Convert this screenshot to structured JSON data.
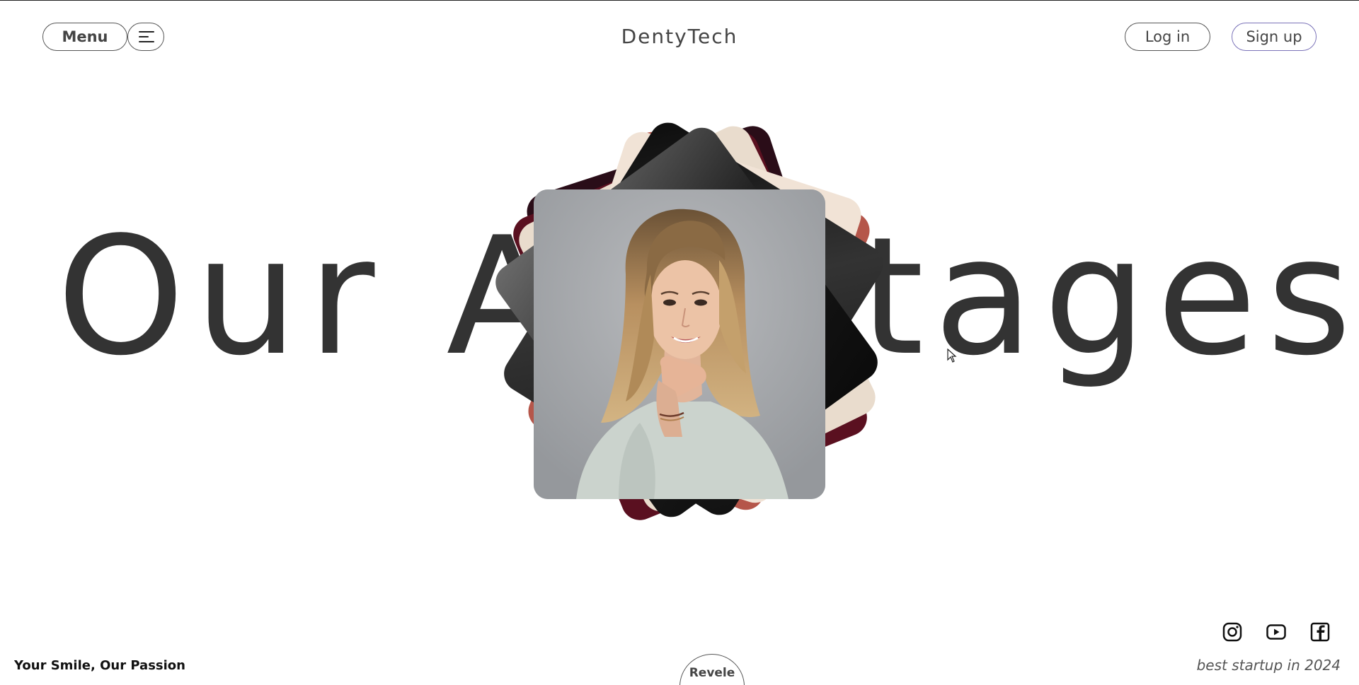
{
  "header": {
    "menu_label": "Menu",
    "brand": "DentyTech",
    "login_label": "Log in",
    "signup_label": "Sign up",
    "hamburger_icon": "hamburger-menu-icon"
  },
  "hero": {
    "word_left": "Our A",
    "word_right": "tages",
    "featured_image": "portrait-of-smiling-woman-with-long-wavy-blonde-hair"
  },
  "footer": {
    "tagline": "Your Smile, Our Passion",
    "revele_label": "Revele",
    "award": "best startup in 2024",
    "social_icons": [
      "instagram-icon",
      "youtube-icon",
      "facebook-icon"
    ]
  },
  "colors": {
    "text": "#333333",
    "border": "#555555",
    "signup_border": "#7a72b8",
    "background": "#ffffff"
  }
}
